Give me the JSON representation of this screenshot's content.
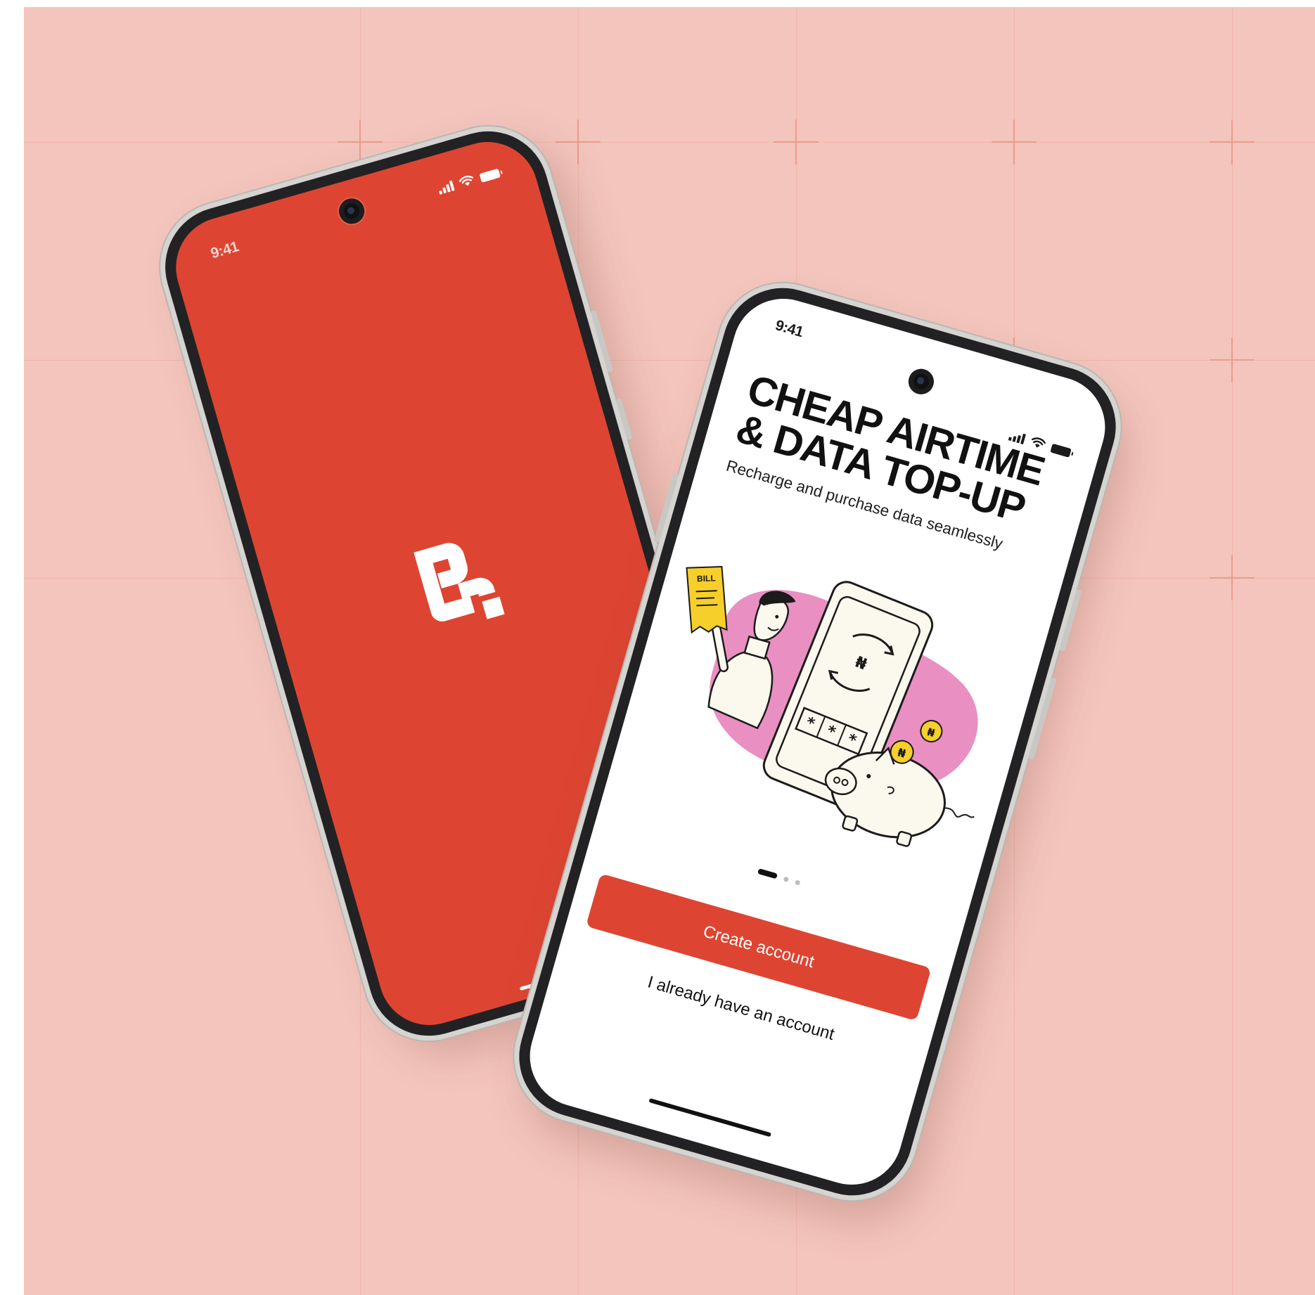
{
  "theme": {
    "background": "#f3c5bc",
    "brand_red": "#dd4532",
    "dark": "#111111"
  },
  "splash_screen": {
    "status_time": "9:41",
    "logo_icon": "brand-logo-icon"
  },
  "onboarding_screen": {
    "status_time": "9:41",
    "headline_line1": "CHEAP AIRTIME",
    "headline_line2": "& DATA TOP-UP",
    "subtitle": "Recharge and purchase data seamlessly",
    "illustration_bill_label": "BILL",
    "illustration_currency": "₦",
    "illustration_pin_masks": [
      "*",
      "*",
      "*"
    ],
    "pager": {
      "total": 3,
      "active": 1
    },
    "primary_button_label": "Create account",
    "secondary_button_label": "I already have an account"
  }
}
